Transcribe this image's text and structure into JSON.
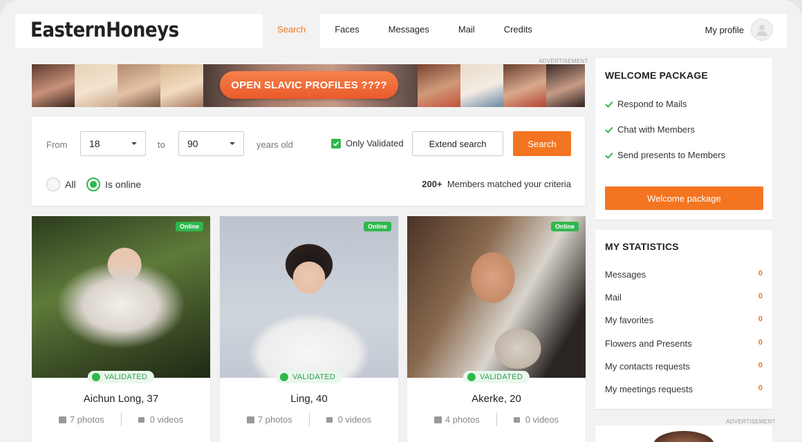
{
  "brand": {
    "logo": "EasternHoneys",
    "accent": "#f47521",
    "green": "#2eb84c"
  },
  "nav": [
    {
      "label": "Search",
      "active": true
    },
    {
      "label": "Faces"
    },
    {
      "label": "Messages"
    },
    {
      "label": "Mail"
    },
    {
      "label": "Credits"
    }
  ],
  "header": {
    "profile_label": "My profile",
    "profile_icon": "user-avatar-icon"
  },
  "ads": {
    "label": "ADVERTISEMENT",
    "banner_button": "OPEN SLAVIC PROFILES ????"
  },
  "search": {
    "from_label": "From",
    "age_from": "18",
    "to_label": "to",
    "age_to": "90",
    "years_label": "years old",
    "only_validated_label": "Only Validated",
    "only_validated_checked": true,
    "extend_label": "Extend search",
    "search_label": "Search",
    "radio_all": "All",
    "radio_online": "Is online",
    "radio_selected": "Is online",
    "matched_count": "200+",
    "matched_text": "Members matched your criteria"
  },
  "profiles": [
    {
      "name": "Aichun Long, 37",
      "status": "Online",
      "badge": "VALIDATED",
      "photos": "7 photos",
      "videos": "0 videos"
    },
    {
      "name": "Ling, 40",
      "status": "Online",
      "badge": "VALIDATED",
      "photos": "7 photos",
      "videos": "0 videos"
    },
    {
      "name": "Akerke, 20",
      "status": "Online",
      "badge": "VALIDATED",
      "photos": "4 photos",
      "videos": "0 videos"
    }
  ],
  "welcome": {
    "title": "WELCOME PACKAGE",
    "items": [
      "Respond to Mails",
      "Chat with Members",
      "Send presents to Members"
    ],
    "button": "Welcome package"
  },
  "stats": {
    "title": "MY STATISTICS",
    "rows": [
      {
        "label": "Messages",
        "value": "0"
      },
      {
        "label": "Mail",
        "value": "0"
      },
      {
        "label": "My favorites",
        "value": "0"
      },
      {
        "label": "Flowers and Presents",
        "value": "0"
      },
      {
        "label": "My contacts requests",
        "value": "0"
      },
      {
        "label": "My meetings requests",
        "value": "0"
      }
    ]
  }
}
